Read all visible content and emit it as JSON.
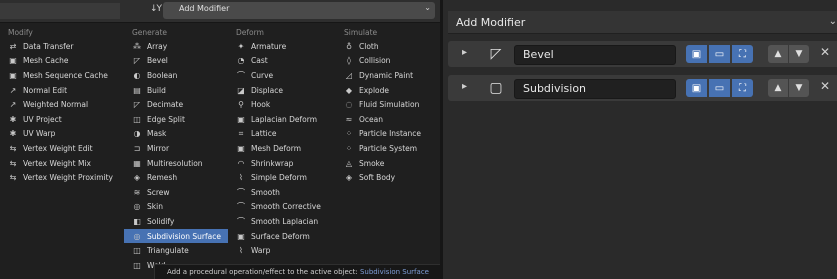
{
  "menu": {
    "title": "Add Modifier",
    "filter_icon": "↓Y",
    "columns": [
      {
        "heading": "Modify",
        "items": [
          {
            "icon": "⇄",
            "label": "Data Transfer"
          },
          {
            "icon": "▣",
            "label": "Mesh Cache"
          },
          {
            "icon": "▣",
            "label": "Mesh Sequence Cache"
          },
          {
            "icon": "↗",
            "label": "Normal Edit"
          },
          {
            "icon": "↗",
            "label": "Weighted Normal"
          },
          {
            "icon": "✱",
            "label": "UV Project"
          },
          {
            "icon": "✱",
            "label": "UV Warp"
          },
          {
            "icon": "⇆",
            "label": "Vertex Weight Edit"
          },
          {
            "icon": "⇆",
            "label": "Vertex Weight Mix"
          },
          {
            "icon": "⇆",
            "label": "Vertex Weight Proximity"
          }
        ]
      },
      {
        "heading": "Generate",
        "items": [
          {
            "icon": "⁂",
            "label": "Array"
          },
          {
            "icon": "◸",
            "label": "Bevel"
          },
          {
            "icon": "◐",
            "label": "Boolean"
          },
          {
            "icon": "▤",
            "label": "Build"
          },
          {
            "icon": "◸",
            "label": "Decimate"
          },
          {
            "icon": "◫",
            "label": "Edge Split"
          },
          {
            "icon": "◑",
            "label": "Mask"
          },
          {
            "icon": "⊐",
            "label": "Mirror"
          },
          {
            "icon": "▦",
            "label": "Multiresolution"
          },
          {
            "icon": "◈",
            "label": "Remesh"
          },
          {
            "icon": "≋",
            "label": "Screw"
          },
          {
            "icon": "◎",
            "label": "Skin"
          },
          {
            "icon": "◧",
            "label": "Solidify"
          },
          {
            "icon": "◎",
            "label": "Subdivision Surface"
          },
          {
            "icon": "◫",
            "label": "Triangulate"
          },
          {
            "icon": "◫",
            "label": "Weld"
          }
        ]
      },
      {
        "heading": "Deform",
        "items": [
          {
            "icon": "✦",
            "label": "Armature"
          },
          {
            "icon": "◔",
            "label": "Cast"
          },
          {
            "icon": "⌒",
            "label": "Curve"
          },
          {
            "icon": "◪",
            "label": "Displace"
          },
          {
            "icon": "⚲",
            "label": "Hook"
          },
          {
            "icon": "▣",
            "label": "Laplacian Deform"
          },
          {
            "icon": "⌗",
            "label": "Lattice"
          },
          {
            "icon": "▣",
            "label": "Mesh Deform"
          },
          {
            "icon": "◠",
            "label": "Shrinkwrap"
          },
          {
            "icon": "⌇",
            "label": "Simple Deform"
          },
          {
            "icon": "⌒",
            "label": "Smooth"
          },
          {
            "icon": "⌒",
            "label": "Smooth Corrective"
          },
          {
            "icon": "⌒",
            "label": "Smooth Laplacian"
          },
          {
            "icon": "▣",
            "label": "Surface Deform"
          },
          {
            "icon": "⌇",
            "label": "Warp"
          }
        ]
      },
      {
        "heading": "Simulate",
        "items": [
          {
            "icon": "♁",
            "label": "Cloth"
          },
          {
            "icon": "◊",
            "label": "Collision"
          },
          {
            "icon": "◿",
            "label": "Dynamic Paint"
          },
          {
            "icon": "◆",
            "label": "Explode"
          },
          {
            "icon": "◌",
            "label": "Fluid Simulation"
          },
          {
            "icon": "≈",
            "label": "Ocean"
          },
          {
            "icon": "⁘",
            "label": "Particle Instance"
          },
          {
            "icon": "⁘",
            "label": "Particle System"
          },
          {
            "icon": "◬",
            "label": "Smoke"
          },
          {
            "icon": "◈",
            "label": "Soft Body"
          }
        ]
      }
    ],
    "highlighted": "Subdivision Surface",
    "tooltip": {
      "text": "Add a procedural operation/effect to the active object:",
      "accent": "Subdivision Surface"
    }
  },
  "panel": {
    "add_modifier_label": "Add Modifier",
    "modifiers": [
      {
        "name": "Bevel",
        "icon": "◸"
      },
      {
        "name": "Subdivision",
        "icon": "▢"
      }
    ]
  },
  "colors": {
    "accent": "#4772b3",
    "background": "#2b2b2b",
    "menu_bg": "#1f1f1f"
  }
}
